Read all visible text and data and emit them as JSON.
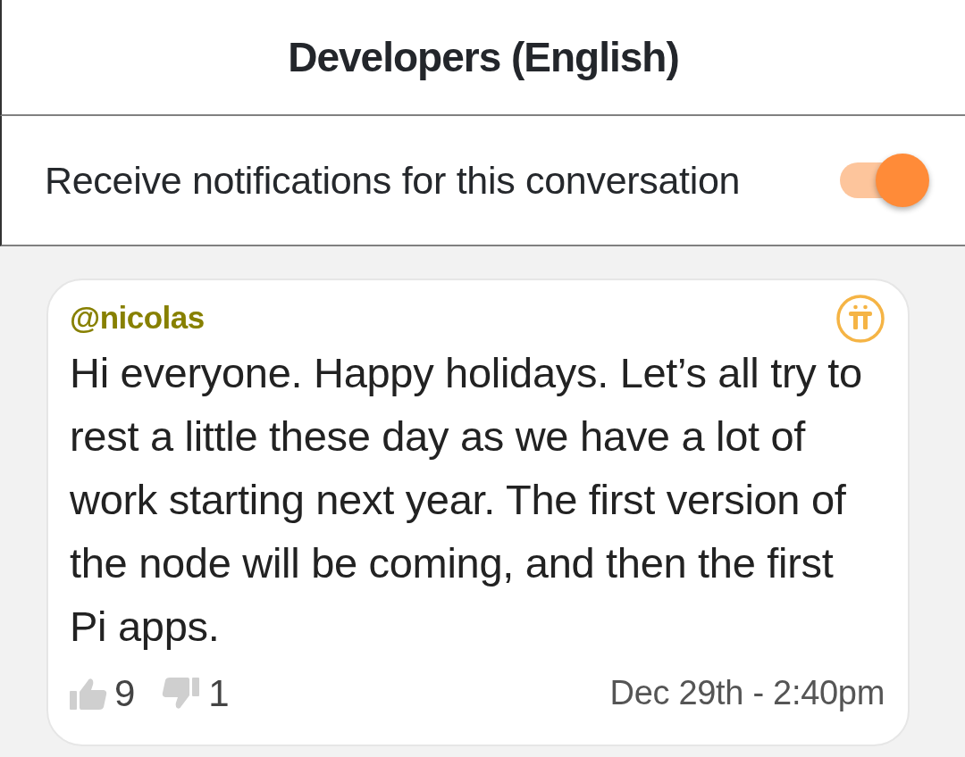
{
  "header": {
    "title": "Developers (English)"
  },
  "notification_setting": {
    "label": "Receive notifications for this conversation",
    "on": true
  },
  "messages": [
    {
      "author": "@nicolas",
      "text": "Hi everyone. Happy holidays. Let’s all try to rest a little these day as we have a lot of work starting next year. The first version of the node will be coming, and then the first Pi apps.",
      "likes": "9",
      "dislikes": "1",
      "timestamp": "Dec 29th - 2:40pm"
    }
  ]
}
